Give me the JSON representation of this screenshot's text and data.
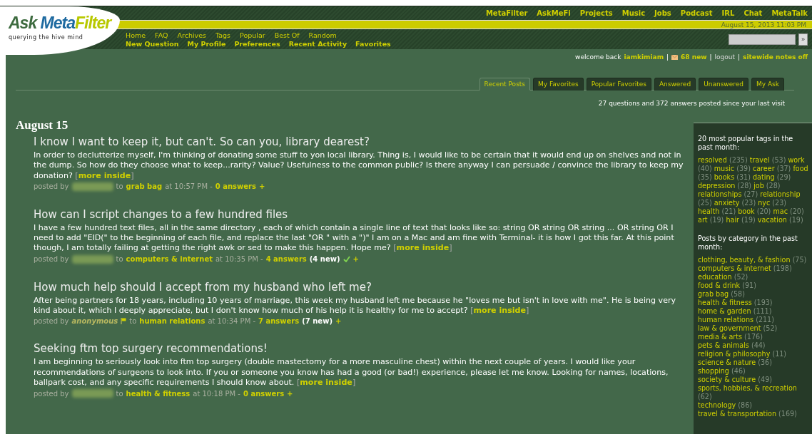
{
  "logo": {
    "ask": "Ask",
    "meta": "Meta",
    "filter": "Filter",
    "tagline": "querying the hive mind"
  },
  "site_nav": [
    "MetaFilter",
    "AskMeFi",
    "Projects",
    "Music",
    "Jobs",
    "Podcast",
    "IRL",
    "Chat",
    "MetaTalk"
  ],
  "date": "August 15, 2013 11:03 PM",
  "nav_primary": [
    "Home",
    "FAQ",
    "Archives",
    "Tags",
    "Popular",
    "Best Of",
    "Random"
  ],
  "nav_secondary": [
    "New Question",
    "My Profile",
    "Preferences",
    "Recent Activity",
    "Favorites"
  ],
  "search": {
    "button": "»"
  },
  "welcome": {
    "prefix": "welcome back",
    "user": "iamkimiam",
    "separator": "|",
    "mail": "68 new",
    "logout": "logout",
    "notes": "sitewide notes off"
  },
  "tabs": [
    {
      "label": "Recent Posts",
      "selected": true
    },
    {
      "label": "My Favorites",
      "selected": false
    },
    {
      "label": "Popular Favorites",
      "selected": false
    },
    {
      "label": "Answered",
      "selected": false
    },
    {
      "label": "Unanswered",
      "selected": false
    },
    {
      "label": "My Ask",
      "selected": false
    }
  ],
  "summary": "27 questions and 372 answers posted since your last visit",
  "day": "August 15",
  "posts": [
    {
      "title": "I know I want to keep it, but can't. So can you, library dearest?",
      "body": "In order to declutterize myself, I'm thinking of donating some stuff to yon local library. Thing is, I would like to be certain that it would end up on shelves and not in the dump. So how do they choose what to keep...rarity? Value? Usefulness to the common public? Is there anyway I can persuade / convince the library to keep my donation?",
      "more": {
        "open": "[",
        "link": "more inside",
        "close": "]"
      },
      "byline": {
        "posted_by": "posted by",
        "author_hidden": true,
        "to": "to",
        "category": "grab bag",
        "time": "at 10:57 PM -",
        "answers": "0 answers",
        "resolved": false,
        "plus": "+"
      }
    },
    {
      "title": "How can I script changes to a few hundred files",
      "body": "I have a few hundred text files, all in the same directory , each of which contain a single line of text that looks like so: string OR string OR string ... OR string OR I need to add \"EID(\" to the beginning of each file, and replace the last \"OR \" with a \")\" I am on a Mac and am fine with Terminal- it is how I got this far. At this point though, I am totally failing at getting the right awk or sed to make this happen. Hope me?",
      "more": {
        "open": "[",
        "link": "more inside",
        "close": "]"
      },
      "byline": {
        "posted_by": "posted by",
        "author_hidden": true,
        "to": "to",
        "category": "computers & internet",
        "time": "at 10:35 PM -",
        "answers": "4 answers",
        "new_count": "(4 new)",
        "resolved": true,
        "plus": "+"
      }
    },
    {
      "title": "How much help should I accept from my husband who left me?",
      "body": "After being partners for 18 years, including 10 years of marriage, this week my husband left me because he \"loves me but isn't in love with me\". He is being very kind about it, which I deeply appreciate, but I don't know how much of his help it is healthy for me to accept?",
      "more": {
        "open": "[",
        "link": "more inside",
        "close": "]"
      },
      "byline": {
        "posted_by": "posted by",
        "author_hidden": false,
        "author": "anonymous",
        "to": "to",
        "category": "human relations",
        "time": "at 10:34 PM -",
        "answers": "7 answers",
        "new_count": "(7 new)",
        "resolved": false,
        "plus": "+"
      }
    },
    {
      "title": "Seeking ftm top surgery recommendations!",
      "body": "I am beginning to seriously look into ftm top surgery (double mastectomy for a more masculine chest) within the next couple of years. I would like your recommendations of surgeons to look into. If you or someone you know has had a good (or bad!) experience, please let me know. Looking for names, locations, ballpark cost, and any specific requirements I should know about.",
      "more": {
        "open": "[",
        "link": "more inside",
        "close": "]"
      },
      "byline": {
        "posted_by": "posted by",
        "author_hidden": true,
        "to": "to",
        "category": "health & fitness",
        "time": "at 10:18 PM -",
        "answers": "0 answers",
        "resolved": false,
        "plus": "+"
      }
    }
  ],
  "sidebar": {
    "tags_heading": "20 most popular tags in the past month:",
    "tags": [
      {
        "name": "resolved",
        "count": "(235)"
      },
      {
        "name": "travel",
        "count": "(53)"
      },
      {
        "name": "work",
        "count": "(40)"
      },
      {
        "name": "music",
        "count": "(39)"
      },
      {
        "name": "career",
        "count": "(37)"
      },
      {
        "name": "food",
        "count": "(35)"
      },
      {
        "name": "books",
        "count": "(31)"
      },
      {
        "name": "dating",
        "count": "(29)"
      },
      {
        "name": "depression",
        "count": "(28)"
      },
      {
        "name": "job",
        "count": "(28)"
      },
      {
        "name": "relationships",
        "count": "(27)"
      },
      {
        "name": "relationship",
        "count": "(25)"
      },
      {
        "name": "anxiety",
        "count": "(23)"
      },
      {
        "name": "nyc",
        "count": "(23)"
      },
      {
        "name": "health",
        "count": "(21)"
      },
      {
        "name": "book",
        "count": "(20)"
      },
      {
        "name": "mac",
        "count": "(20)"
      },
      {
        "name": "art",
        "count": "(19)"
      },
      {
        "name": "hair",
        "count": "(19)"
      },
      {
        "name": "vacation",
        "count": "(19)"
      }
    ],
    "categories_heading": "Posts by category in the past month:",
    "categories": [
      {
        "name": "clothing, beauty, & fashion",
        "count": "(75)"
      },
      {
        "name": "computers & internet",
        "count": "(198)"
      },
      {
        "name": "education",
        "count": "(52)"
      },
      {
        "name": "food & drink",
        "count": "(91)"
      },
      {
        "name": "grab bag",
        "count": "(58)"
      },
      {
        "name": "health & fitness",
        "count": "(193)"
      },
      {
        "name": "home & garden",
        "count": "(111)"
      },
      {
        "name": "human relations",
        "count": "(211)"
      },
      {
        "name": "law & government",
        "count": "(52)"
      },
      {
        "name": "media & arts",
        "count": "(176)"
      },
      {
        "name": "pets & animals",
        "count": "(44)"
      },
      {
        "name": "religion & philosophy",
        "count": "(11)"
      },
      {
        "name": "science & nature",
        "count": "(36)"
      },
      {
        "name": "shopping",
        "count": "(46)"
      },
      {
        "name": "society & culture",
        "count": "(49)"
      },
      {
        "name": "sports, hobbies, & recreation",
        "count": "(62)"
      },
      {
        "name": "technology",
        "count": "(86)"
      },
      {
        "name": "travel & transportation",
        "count": "(169)"
      }
    ]
  }
}
